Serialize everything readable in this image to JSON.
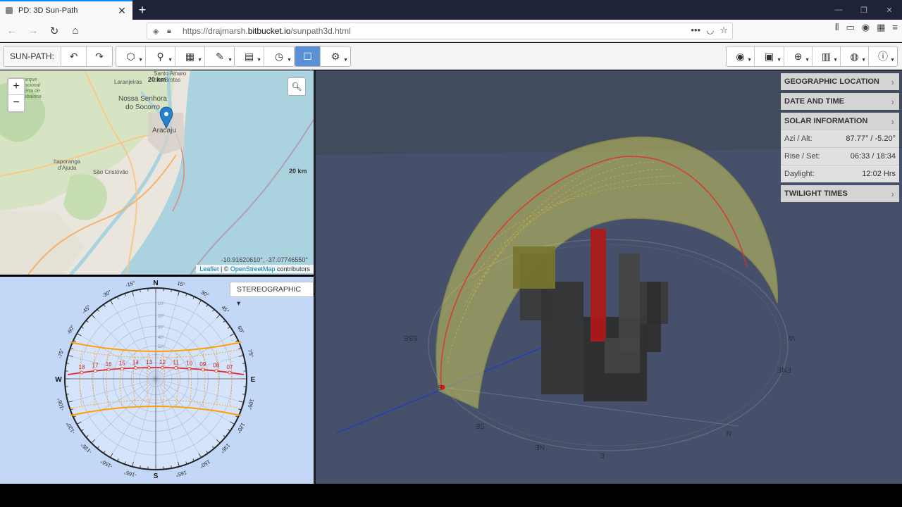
{
  "browser": {
    "tab_title": "PD: 3D Sun-Path",
    "url_prefix": "https://drajmarsh.",
    "url_domain": "bitbucket.io",
    "url_path": "/sunpath3d.html"
  },
  "toolbar": {
    "label": "SUN-PATH:",
    "undo_icon": "undo-icon",
    "redo_icon": "redo-icon",
    "left_tools": [
      "model-icon",
      "site-icon",
      "grid-icon",
      "draw-icon",
      "calendar-icon",
      "clock-icon",
      "view-toggle-icon",
      "settings-icon"
    ],
    "right_tools": [
      "eye-icon",
      "display-icon",
      "sky-icon",
      "schedule-icon",
      "globe-icon",
      "info-icon"
    ]
  },
  "map": {
    "zoom_in": "+",
    "zoom_out": "−",
    "scale_top": "20 km",
    "scale_right": "20 km",
    "coords": "-10.91620610°, -37.07746550°",
    "attribution_leaflet": "Leaflet",
    "attribution_sep": " | © ",
    "attribution_osm": "OpenStreetMap",
    "attribution_tail": " contributors",
    "places": [
      {
        "id": "santo_amaro",
        "label": "Santo Amaro\ndas Brotas"
      },
      {
        "id": "laranjeiras",
        "label": "Laranjeiras"
      },
      {
        "id": "nossa_senhora",
        "label": "Nossa Senhora\ndo Socorro"
      },
      {
        "id": "aracaju",
        "label": "Aracaju"
      },
      {
        "id": "itaporanga",
        "label": "Itaporanga\nd'Ajuda"
      },
      {
        "id": "sao_cristovao",
        "label": "São Cristóvão"
      },
      {
        "id": "parque",
        "label": "Parque\nNacional\nSerra de\nItabaiana"
      }
    ]
  },
  "diagram": {
    "projection_label": "STEREOGRAPHIC ▾",
    "cardinals": {
      "N": "N",
      "S": "S",
      "E": "E",
      "W": "W"
    },
    "azimuth_labels": [
      "-15°",
      "15°",
      "-30°",
      "30°",
      "-45°",
      "45°",
      "-60°",
      "60°",
      "-75°",
      "75°",
      "-105°",
      "105°",
      "-120°",
      "120°",
      "-135°",
      "135°",
      "-150°",
      "150°",
      "-165°",
      "165°"
    ],
    "altitude_labels": [
      "10°",
      "20°",
      "30°",
      "40°",
      "50°"
    ],
    "hours": [
      "18",
      "17",
      "16",
      "15",
      "14",
      "13",
      "12",
      "11",
      "10",
      "09",
      "08",
      "07"
    ]
  },
  "view3d": {
    "compass_labels": [
      "S",
      "SE",
      "N",
      "NE",
      "E",
      "W",
      "SSE",
      "ENE"
    ]
  },
  "info": {
    "geo_header": "GEOGRAPHIC LOCATION",
    "date_header": "DATE AND TIME",
    "solar_header": "SOLAR INFORMATION",
    "rows": [
      {
        "label": "Azi / Alt:",
        "value": "87.77° / -5.20°"
      },
      {
        "label": "Rise / Set:",
        "value": "06:33 / 18:34"
      },
      {
        "label": "Daylight:",
        "value": "12:02 Hrs"
      }
    ],
    "twilight_header": "TWILIGHT TIMES",
    "chevron": "›"
  },
  "colors": {
    "sunpath": "#ffa000",
    "sun_line": "#e32a2a",
    "dome": "#e6e25a",
    "viewport": "#424a5e",
    "diagram_bg": "#c3d7f7",
    "active_tool": "#5b8fd6"
  }
}
